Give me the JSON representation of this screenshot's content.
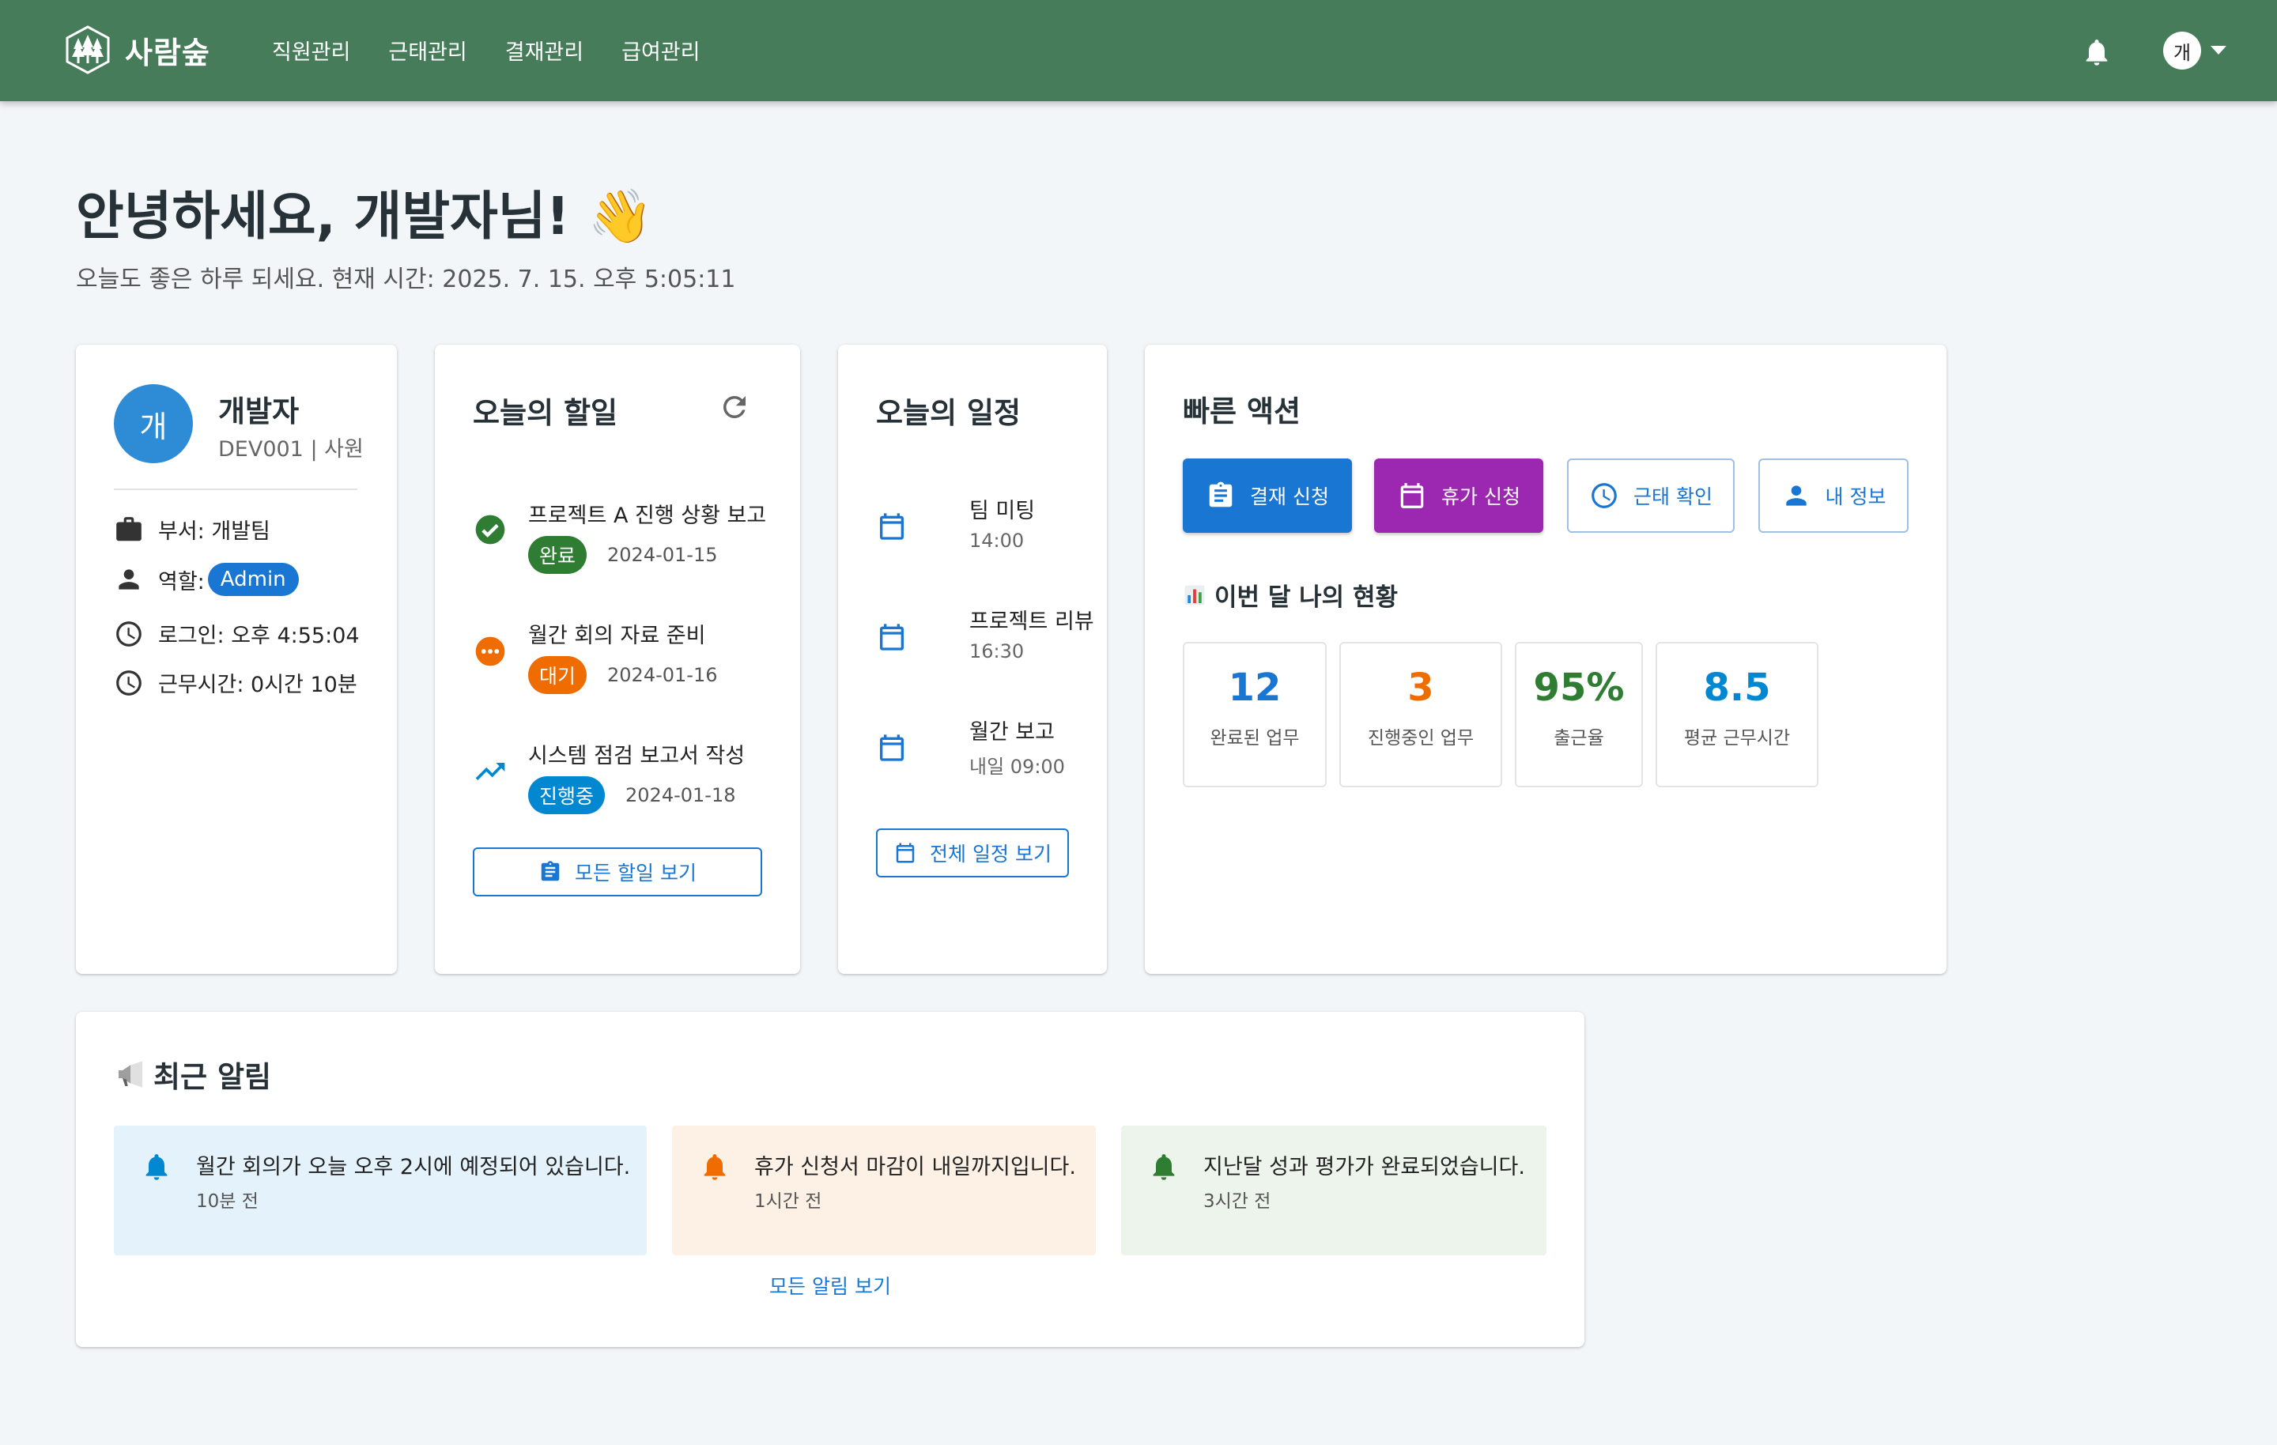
{
  "header": {
    "brand": "사람숲",
    "nav": [
      "직원관리",
      "근태관리",
      "결재관리",
      "급여관리"
    ],
    "avatar_text": "개",
    "bar_color": "#467c5a"
  },
  "greeting": {
    "title": "안녕하세요, 개발자님! 👋",
    "subtitle": "오늘도 좋은 하루 되세요. 현재 시간: 2025. 7. 15. 오후 5:05:11"
  },
  "profile": {
    "avatar_text": "개",
    "name": "개발자",
    "code": "DEV001 | 사원",
    "dept": "부서: 개발팀",
    "role_label": "역할:",
    "role": "Admin",
    "login": "로그인: 오후 4:55:04",
    "work_time": "근무시간: 0시간 10분"
  },
  "todo": {
    "title": "오늘의 할일",
    "items": [
      {
        "text": "프로젝트 A 진행 상황 보고",
        "status": "완료",
        "date": "2024-01-15",
        "icon": "check-circle-icon",
        "color": "#2e7d32"
      },
      {
        "text": "월간 회의 자료 준비",
        "status": "대기",
        "date": "2024-01-16",
        "icon": "more-circle-icon",
        "color": "#ef6c00"
      },
      {
        "text": "시스템 점검 보고서 작성",
        "status": "진행중",
        "date": "2024-01-18",
        "icon": "trending-up-icon",
        "color": "#0288d1"
      }
    ],
    "all_button": "모든 할일 보기"
  },
  "schedule": {
    "title": "오늘의 일정",
    "items": [
      {
        "title": "팀 미팅",
        "time": "14:00"
      },
      {
        "title": "프로젝트 리뷰",
        "time": "16:30"
      },
      {
        "title": "월간 보고",
        "time": "내일 09:00"
      }
    ],
    "all_button": "전체 일정 보기"
  },
  "quick_actions": {
    "title": "빠른 액션",
    "buttons": [
      "결재 신청",
      "휴가 신청",
      "근태 확인",
      "내 정보"
    ],
    "stats_title": "이번 달 나의 현황",
    "stats": [
      {
        "value": "12",
        "label": "완료된 업무",
        "color": "#1976d2"
      },
      {
        "value": "3",
        "label": "진행중인 업무",
        "color": "#ef6c00"
      },
      {
        "value": "95%",
        "label": "출근율",
        "color": "#2e7d32"
      },
      {
        "value": "8.5",
        "label": "평균 근무시간",
        "color": "#0288d1"
      }
    ]
  },
  "notifications": {
    "title": "최근 알림",
    "items": [
      {
        "text": "월간 회의가 오늘 오후 2시에 예정되어 있습니다.",
        "time": "10분 전",
        "bg": "#e3f2fb",
        "icon_color": "#0288d1"
      },
      {
        "text": "휴가 신청서 마감이 내일까지입니다.",
        "time": "1시간 전",
        "bg": "#fdf1e5",
        "icon_color": "#ef6c00"
      },
      {
        "text": "지난달 성과 평가가 완료되었습니다.",
        "time": "3시간 전",
        "bg": "#ecf4ec",
        "icon_color": "#2e7d32"
      }
    ],
    "all_link": "모든 알림 보기"
  }
}
